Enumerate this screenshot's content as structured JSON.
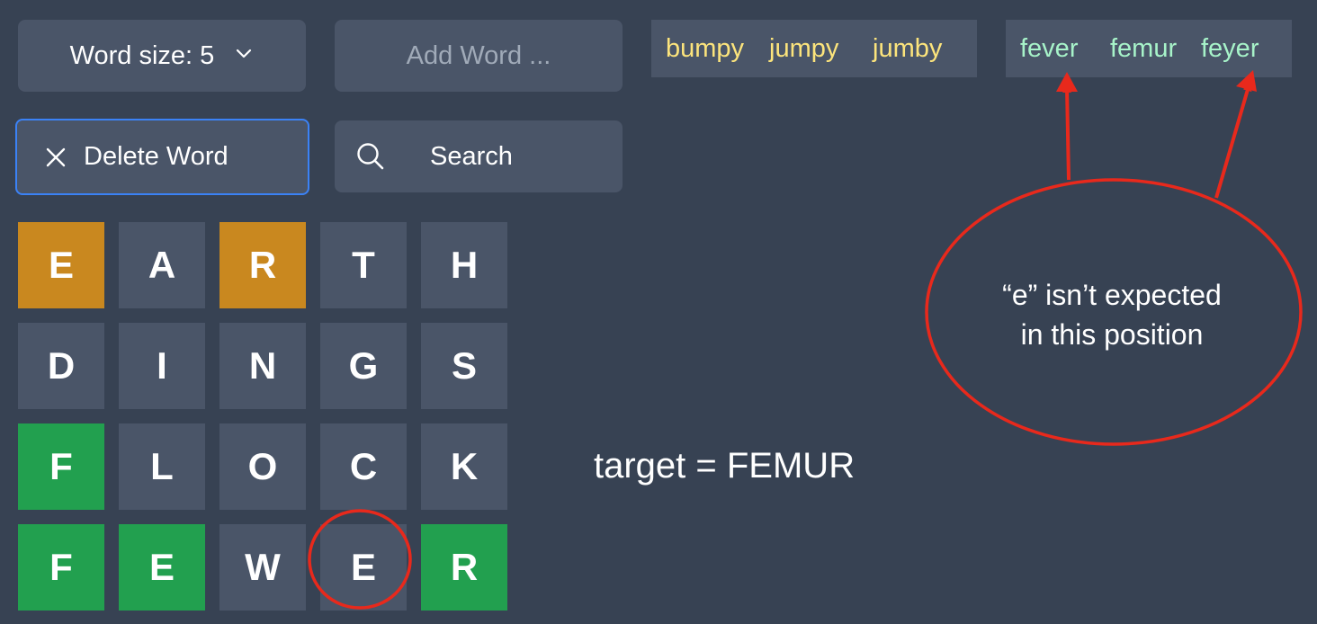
{
  "controls": {
    "word_size_label": "Word size: 5",
    "add_word_placeholder": "Add Word ...",
    "delete_word_label": "Delete Word",
    "search_label": "Search"
  },
  "suggestions": {
    "partial_matches": [
      "bumpy",
      "jumpy",
      "jumby"
    ],
    "full_matches": [
      "fever",
      "femur",
      "feyer"
    ]
  },
  "grid": {
    "rows": [
      [
        {
          "letter": "E",
          "state": "present"
        },
        {
          "letter": "A",
          "state": "absent"
        },
        {
          "letter": "R",
          "state": "present"
        },
        {
          "letter": "T",
          "state": "absent"
        },
        {
          "letter": "H",
          "state": "absent"
        }
      ],
      [
        {
          "letter": "D",
          "state": "absent"
        },
        {
          "letter": "I",
          "state": "absent"
        },
        {
          "letter": "N",
          "state": "absent"
        },
        {
          "letter": "G",
          "state": "absent"
        },
        {
          "letter": "S",
          "state": "absent"
        }
      ],
      [
        {
          "letter": "F",
          "state": "correct"
        },
        {
          "letter": "L",
          "state": "absent"
        },
        {
          "letter": "O",
          "state": "absent"
        },
        {
          "letter": "C",
          "state": "absent"
        },
        {
          "letter": "K",
          "state": "absent"
        }
      ],
      [
        {
          "letter": "F",
          "state": "correct"
        },
        {
          "letter": "E",
          "state": "correct"
        },
        {
          "letter": "W",
          "state": "absent"
        },
        {
          "letter": "E",
          "state": "absent"
        },
        {
          "letter": "R",
          "state": "correct"
        }
      ]
    ]
  },
  "annotations": {
    "target_label": "target = FEMUR",
    "callout_line1": "“e” isn’t expected",
    "callout_line2": "in this position"
  },
  "colors": {
    "background": "#374253",
    "tile_default": "#4a5568",
    "tile_present": "#c9881f",
    "tile_correct": "#22a04f",
    "partial_match_text": "#fce47c",
    "full_match_text": "#a7f3c9",
    "annotation_red": "#e8291c",
    "focus_border": "#3b82f6"
  },
  "icons": {
    "word_size": "chevron-down-icon",
    "delete": "close-icon",
    "search": "search-icon"
  }
}
